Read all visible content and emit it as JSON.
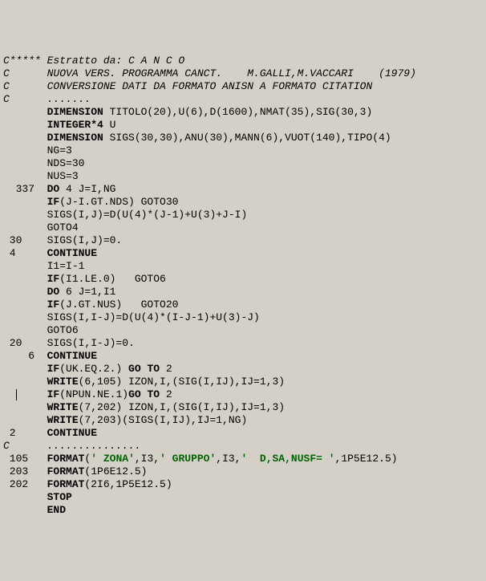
{
  "lines": [
    {
      "indent": "",
      "segs": [
        {
          "t": "C***** Estratto da: C A N C O",
          "cls": "i"
        }
      ]
    },
    {
      "indent": "",
      "segs": [
        {
          "t": "C      NUOVA VERS. PROGRAMMA CANCT.    M.GALLI,M.VACCARI    (1979)",
          "cls": "i"
        }
      ]
    },
    {
      "indent": "",
      "segs": [
        {
          "t": "C      CONVERSIONE DATI DA FORMATO ANISN A FORMATO CITATION",
          "cls": "i"
        }
      ]
    },
    {
      "indent": "",
      "segs": [
        {
          "t": "C      .......",
          "cls": "i"
        }
      ]
    },
    {
      "indent": "",
      "segs": [
        {
          "t": ""
        }
      ]
    },
    {
      "indent": "       ",
      "segs": [
        {
          "t": "DIMENSION",
          "cls": "b"
        },
        {
          "t": " TITOLO(20),U(6),D(1600),NMAT(35),SIG(30,3)"
        }
      ]
    },
    {
      "indent": "       ",
      "segs": [
        {
          "t": "INTEGER*4",
          "cls": "b"
        },
        {
          "t": " U"
        }
      ]
    },
    {
      "indent": "       ",
      "segs": [
        {
          "t": "DIMENSION",
          "cls": "b"
        },
        {
          "t": " SIGS(30,30),ANU(30),MANN(6),VUOT(140),TIPO(4)"
        }
      ]
    },
    {
      "indent": "",
      "segs": [
        {
          "t": ""
        }
      ]
    },
    {
      "indent": "",
      "segs": [
        {
          "t": ""
        }
      ]
    },
    {
      "indent": "       ",
      "segs": [
        {
          "t": "NG=3"
        }
      ]
    },
    {
      "indent": "       ",
      "segs": [
        {
          "t": "NDS=30"
        }
      ]
    },
    {
      "indent": "       ",
      "segs": [
        {
          "t": "NUS=3"
        }
      ]
    },
    {
      "indent": "",
      "segs": [
        {
          "t": ""
        }
      ]
    },
    {
      "indent": "  337  ",
      "segs": [
        {
          "t": "DO",
          "cls": "b"
        },
        {
          "t": " 4 J=I,NG"
        }
      ]
    },
    {
      "indent": "       ",
      "segs": [
        {
          "t": "IF",
          "cls": "b"
        },
        {
          "t": "(J-I.GT.NDS) GOTO30"
        }
      ]
    },
    {
      "indent": "       ",
      "segs": [
        {
          "t": "SIGS(I,J)=D(U(4)*(J-1)+U(3)+J-I)"
        }
      ]
    },
    {
      "indent": "       ",
      "segs": [
        {
          "t": "GOTO4"
        }
      ]
    },
    {
      "indent": " 30    ",
      "segs": [
        {
          "t": "SIGS(I,J)=0."
        }
      ]
    },
    {
      "indent": " 4     ",
      "segs": [
        {
          "t": "CONTINUE",
          "cls": "b"
        }
      ]
    },
    {
      "indent": "       ",
      "segs": [
        {
          "t": "I1=I-1"
        }
      ]
    },
    {
      "indent": "       ",
      "segs": [
        {
          "t": "IF",
          "cls": "b"
        },
        {
          "t": "(I1.LE.0)   GOTO6"
        }
      ]
    },
    {
      "indent": "       ",
      "segs": [
        {
          "t": "DO",
          "cls": "b"
        },
        {
          "t": " 6 J=1,I1"
        }
      ]
    },
    {
      "indent": "       ",
      "segs": [
        {
          "t": "IF",
          "cls": "b"
        },
        {
          "t": "(J.GT.NUS)   GOTO20"
        }
      ]
    },
    {
      "indent": "       ",
      "segs": [
        {
          "t": "SIGS(I,I-J)=D(U(4)*(I-J-1)+U(3)-J)"
        }
      ]
    },
    {
      "indent": "       ",
      "segs": [
        {
          "t": "GOTO6"
        }
      ]
    },
    {
      "indent": " 20    ",
      "segs": [
        {
          "t": "SIGS(I,I-J)=0."
        }
      ]
    },
    {
      "indent": "    6  ",
      "segs": [
        {
          "t": "CONTINUE",
          "cls": "b"
        }
      ]
    },
    {
      "indent": "       ",
      "segs": [
        {
          "t": "IF",
          "cls": "b"
        },
        {
          "t": "(UK.EQ.2.) "
        },
        {
          "t": "GO TO",
          "cls": "b"
        },
        {
          "t": " 2"
        }
      ]
    },
    {
      "indent": "       ",
      "segs": [
        {
          "t": "WRITE",
          "cls": "b"
        },
        {
          "t": "(6,105) IZON,I,(SIG(I,IJ),IJ=1,3)"
        }
      ]
    },
    {
      "indent": "",
      "cursor": true,
      "cursorPrefix": "  ",
      "segs": [
        {
          "t": "     "
        },
        {
          "t": "IF",
          "cls": "b"
        },
        {
          "t": "(NPUN.NE.1)"
        },
        {
          "t": "GO TO",
          "cls": "b"
        },
        {
          "t": " 2"
        }
      ]
    },
    {
      "indent": "       ",
      "segs": [
        {
          "t": "WRITE",
          "cls": "b"
        },
        {
          "t": "(7,202) IZON,I,(SIG(I,IJ),IJ=1,3)"
        }
      ]
    },
    {
      "indent": "       ",
      "segs": [
        {
          "t": "WRITE",
          "cls": "b"
        },
        {
          "t": "(7,203)(SIGS(I,IJ),IJ=1,NG)"
        }
      ]
    },
    {
      "indent": " 2     ",
      "segs": [
        {
          "t": "CONTINUE",
          "cls": "b"
        }
      ]
    },
    {
      "indent": "",
      "segs": [
        {
          "t": ""
        }
      ]
    },
    {
      "indent": "",
      "segs": [
        {
          "t": "C      ...............",
          "cls": "i"
        }
      ]
    },
    {
      "indent": "",
      "segs": [
        {
          "t": ""
        }
      ]
    },
    {
      "indent": " 105   ",
      "segs": [
        {
          "t": "FORMAT",
          "cls": "b"
        },
        {
          "t": "("
        },
        {
          "t": "' ZONA'",
          "cls": "str"
        },
        {
          "t": ",I3,"
        },
        {
          "t": "' GRUPPO'",
          "cls": "str"
        },
        {
          "t": ",I3,"
        },
        {
          "t": "'  D,SA,NUSF= '",
          "cls": "str"
        },
        {
          "t": ",1P5E12.5)"
        }
      ]
    },
    {
      "indent": " 203   ",
      "segs": [
        {
          "t": "FORMAT",
          "cls": "b"
        },
        {
          "t": "(1P6E12.5)"
        }
      ]
    },
    {
      "indent": " 202   ",
      "segs": [
        {
          "t": "FORMAT",
          "cls": "b"
        },
        {
          "t": "(2I6,1P5E12.5)"
        }
      ]
    },
    {
      "indent": "",
      "segs": [
        {
          "t": ""
        }
      ]
    },
    {
      "indent": "       ",
      "segs": [
        {
          "t": "STOP",
          "cls": "b"
        }
      ]
    },
    {
      "indent": "       ",
      "segs": [
        {
          "t": "END",
          "cls": "b"
        }
      ]
    }
  ]
}
